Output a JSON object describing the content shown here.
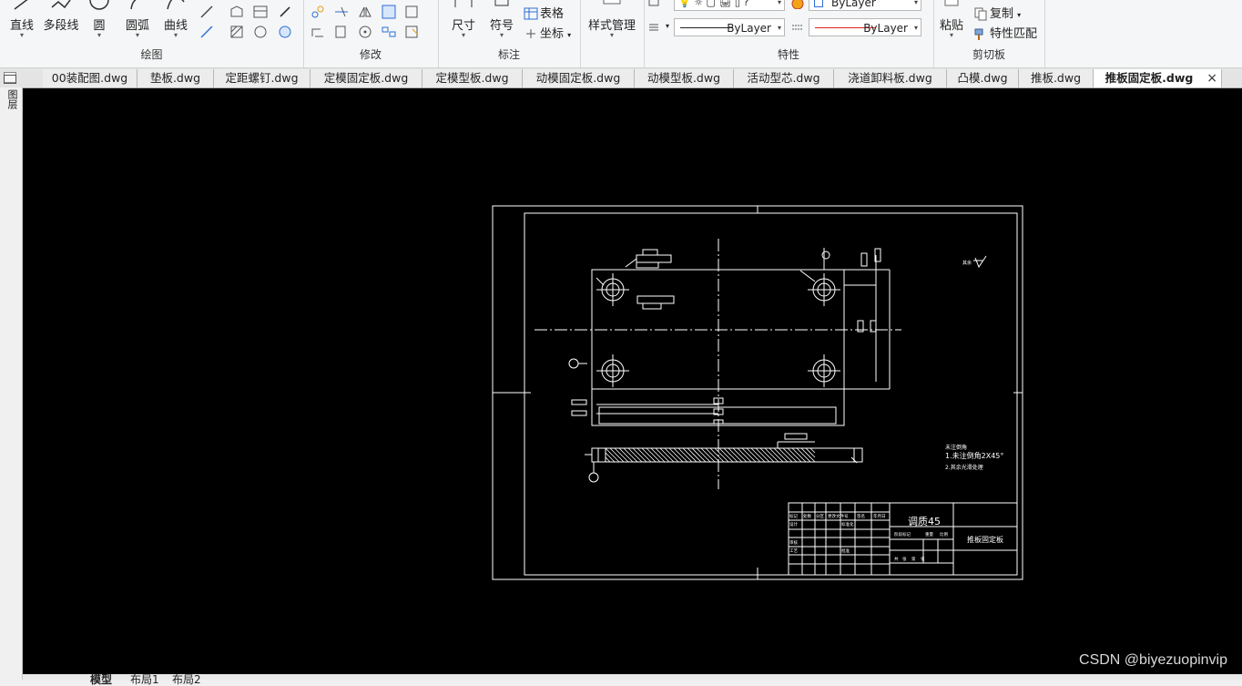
{
  "ribbon": {
    "draw": {
      "label": "绘图",
      "buttons": [
        "直线",
        "多段线",
        "圆",
        "圆弧",
        "曲线"
      ]
    },
    "modify": {
      "label": "修改"
    },
    "annotate": {
      "label": "标注",
      "dimension": "尺寸",
      "symbol": "符号",
      "table": "表格",
      "coordinate": "坐标"
    },
    "style": {
      "manager": "样式管理"
    },
    "properties": {
      "label": "特性",
      "layer_value": "ByLayer",
      "linetype_value": "ByLayer",
      "color_value": "ByLayer"
    },
    "clipboard": {
      "label": "剪切板",
      "paste": "粘贴",
      "copy": "复制",
      "match": "特性匹配"
    }
  },
  "tabs": [
    "00装配图.dwg",
    "垫板.dwg",
    "定距螺钉.dwg",
    "定模固定板.dwg",
    "定模型板.dwg",
    "动模固定板.dwg",
    "动模型板.dwg",
    "活动型芯.dwg",
    "浇道卸料板.dwg",
    "凸模.dwg",
    "推板.dwg",
    "推板固定板.dwg"
  ],
  "active_tab": "推板固定板.dwg",
  "left_strip_label": "图层",
  "drawing": {
    "material": "调质45",
    "part_name": "推板固定板",
    "tech_title": "未注倒角",
    "tech_lines": [
      "1.未注倒角2X45°",
      "2.其余光滑处理"
    ],
    "rough_note": "其余",
    "tb_labels": [
      "标记",
      "处数",
      "分区",
      "更改文件号",
      "签名",
      "年月日",
      "设计",
      "标准化",
      "审核",
      "工艺",
      "批准",
      "阶段标记",
      "重量",
      "比例",
      "共",
      "张",
      "第",
      "张"
    ]
  },
  "layout_tabs": [
    "模型",
    "布局1",
    "布局2"
  ],
  "watermark": "CSDN @biyezuopinvip",
  "colors": {
    "canvas_bg": "#000000",
    "line": "#ffffff",
    "color_swatch": "#e02020"
  }
}
